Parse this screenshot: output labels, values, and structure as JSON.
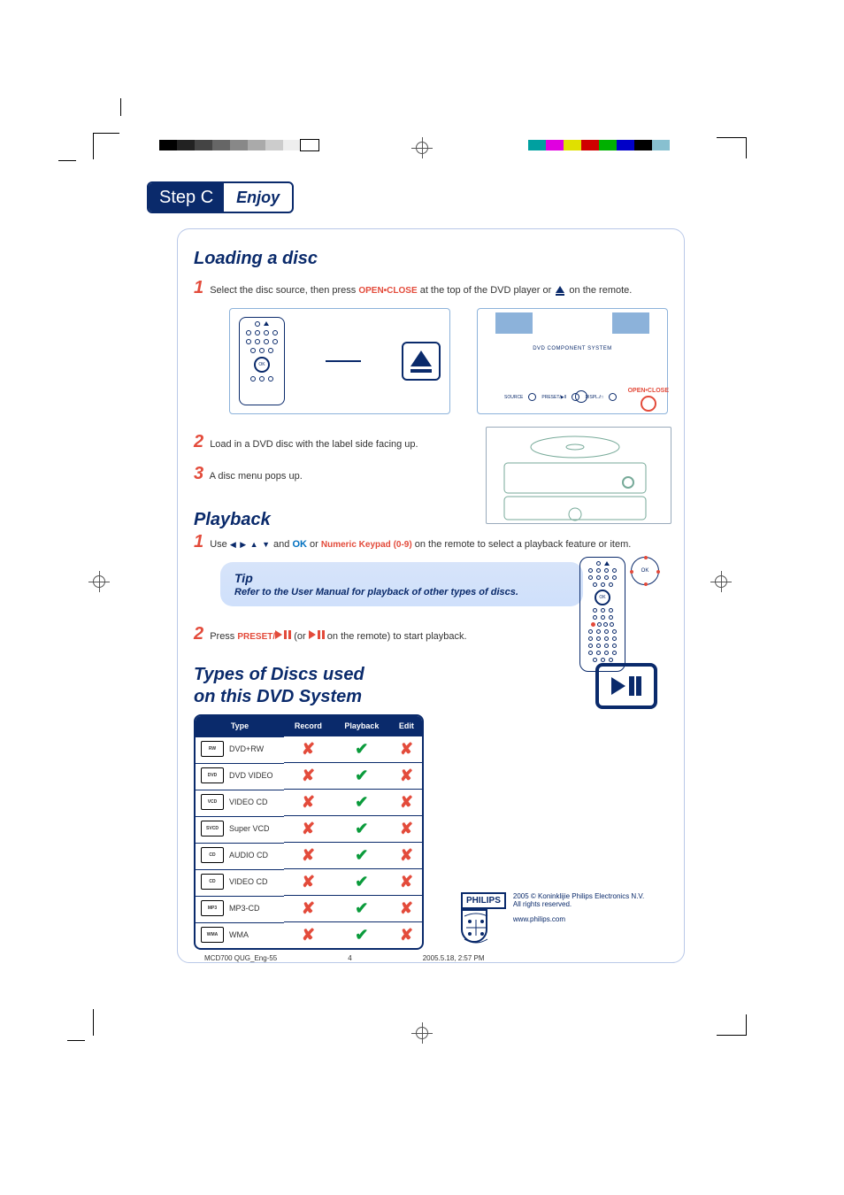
{
  "step": {
    "label_left": "Step C",
    "label_right": "Enjoy"
  },
  "sections": {
    "loading": {
      "title": "Loading a disc",
      "step1_pre": "Select the disc source, then press ",
      "step1_kw": "OPEN•CLOSE",
      "step1_mid": " at the top of the DVD player or ",
      "step1_post": " on the remote.",
      "step2": "Load in a DVD disc with the label side facing up.",
      "step3": "A disc menu pops up.",
      "player_title": "DVD COMPONENT SYSTEM",
      "open_close_label": "OPEN•CLOSE"
    },
    "playback": {
      "title": "Playback",
      "step1_pre": "Use ",
      "step1_arrows": "◀ ▶ ▲ ▼",
      "step1_mid1": " and ",
      "step1_ok": "OK",
      "step1_mid2": " or ",
      "step1_kp": "Numeric Keypad (0-9)",
      "step1_post": " on the remote to select a playback feature or item.",
      "tip_title": "Tip",
      "tip_text": "Refer to the User Manual for playback of other types of discs.",
      "step2_pre": "Press ",
      "step2_kw": "PRESET/",
      "step2_mid": " (or ",
      "step2_post": " on the remote) to start playback."
    },
    "discs": {
      "title_l1": "Types of Discs used",
      "title_l2": "on this DVD System",
      "headers": [
        "Type",
        "Record",
        "Playback",
        "Edit"
      ],
      "rows": [
        {
          "label": "DVD+RW",
          "logo": "RW",
          "record": "x",
          "playback": "v",
          "edit": "x"
        },
        {
          "label": "DVD VIDEO",
          "logo": "DVD",
          "record": "x",
          "playback": "v",
          "edit": "x"
        },
        {
          "label": "VIDEO CD",
          "logo": "VCD",
          "record": "x",
          "playback": "v",
          "edit": "x"
        },
        {
          "label": "Super VCD",
          "logo": "SVCD",
          "record": "x",
          "playback": "v",
          "edit": "x"
        },
        {
          "label": "AUDIO CD",
          "logo": "CD",
          "record": "x",
          "playback": "v",
          "edit": "x"
        },
        {
          "label": "VIDEO CD",
          "logo": "CD",
          "record": "x",
          "playback": "v",
          "edit": "x"
        },
        {
          "label": "MP3-CD",
          "logo": "MP3",
          "record": "x",
          "playback": "v",
          "edit": "x"
        },
        {
          "label": "WMA",
          "logo": "WMA",
          "record": "x",
          "playback": "v",
          "edit": "x"
        }
      ]
    }
  },
  "footer": {
    "brand": "PHILIPS",
    "copyright": "2005 © Koninklijie Philips Electronics N.V.",
    "rights": "All rights reserved.",
    "url": "www.philips.com",
    "doc_id": "MCD700 QUG_Eng-55",
    "page_no": "4",
    "timestamp": "2005.5.18, 2:57 PM"
  },
  "colors": {
    "bw": [
      "#000",
      "#222",
      "#444",
      "#666",
      "#888",
      "#aaa",
      "#ccc",
      "#eee",
      "#fff"
    ],
    "col": [
      "#00a0a0",
      "#e000e0",
      "#e0e000",
      "#d00000",
      "#00b000",
      "#0000c8",
      "#000",
      "#88c0d0"
    ]
  }
}
